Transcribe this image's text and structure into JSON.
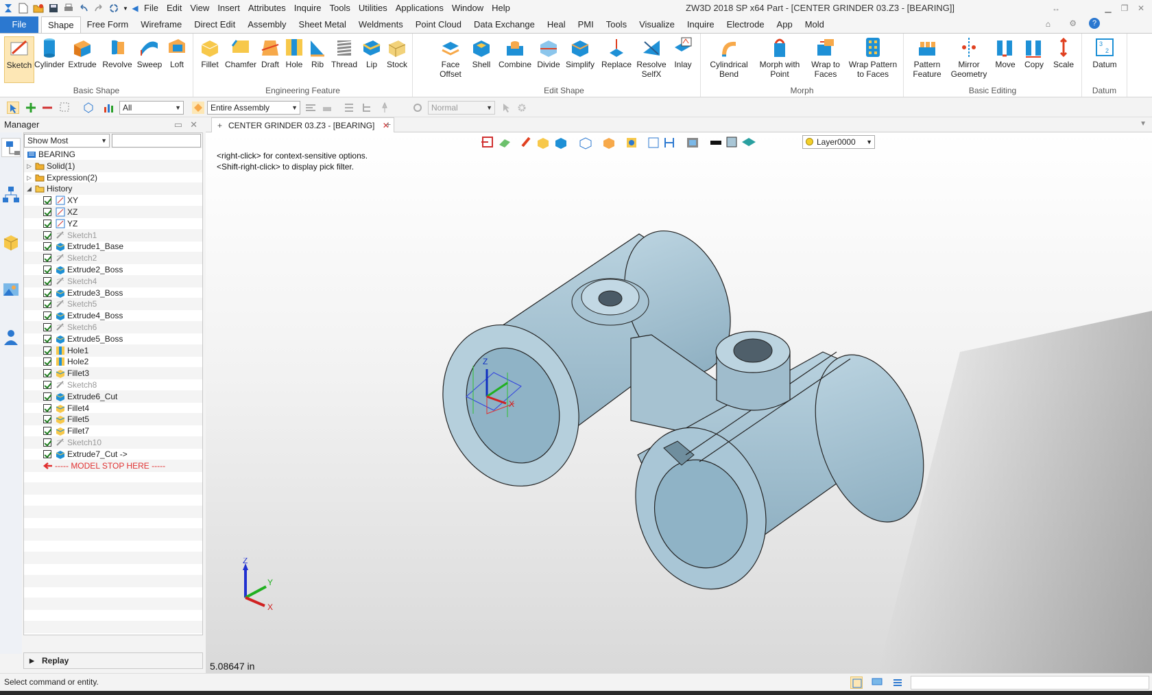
{
  "app": {
    "title": "ZW3D 2018 SP x64     Part - [CENTER GRINDER 03.Z3 - [BEARING]]"
  },
  "menu": [
    "File",
    "Edit",
    "View",
    "Insert",
    "Attributes",
    "Inquire",
    "Tools",
    "Utilities",
    "Applications",
    "Window",
    "Help"
  ],
  "tabs": [
    "File",
    "Shape",
    "Free Form",
    "Wireframe",
    "Direct Edit",
    "Assembly",
    "Sheet Metal",
    "Weldments",
    "Point Cloud",
    "Data Exchange",
    "Heal",
    "PMI",
    "Tools",
    "Visualize",
    "Inquire",
    "Electrode",
    "App",
    "Mold"
  ],
  "ribbon": {
    "groups": {
      "basic_shape": "Basic Shape",
      "engineering_feature": "Engineering Feature",
      "edit_shape": "Edit Shape",
      "morph": "Morph",
      "basic_editing": "Basic Editing",
      "datum": "Datum"
    },
    "buttons": {
      "sketch": "Sketch",
      "cylinder": "Cylinder",
      "extrude": "Extrude",
      "revolve": "Revolve",
      "sweep": "Sweep",
      "loft": "Loft",
      "fillet": "Fillet",
      "chamfer": "Chamfer",
      "draft": "Draft",
      "hole": "Hole",
      "rib": "Rib",
      "thread": "Thread",
      "lip": "Lip",
      "stock": "Stock",
      "face_offset_1": "Face",
      "face_offset_2": "Offset",
      "shell": "Shell",
      "combine": "Combine",
      "divide": "Divide",
      "simplify": "Simplify",
      "replace": "Replace",
      "resolve_1": "Resolve",
      "resolve_2": "SelfX",
      "inlay": "Inlay",
      "cyl_bend_1": "Cylindrical",
      "cyl_bend_2": "Bend",
      "morph_pt_1": "Morph with",
      "morph_pt_2": "Point",
      "wrap_faces_1": "Wrap to",
      "wrap_faces_2": "Faces",
      "wrap_pattern_1": "Wrap Pattern",
      "wrap_pattern_2": "to Faces",
      "pattern_1": "Pattern",
      "pattern_2": "Feature",
      "mirror_1": "Mirror",
      "mirror_2": "Geometry",
      "move": "Move",
      "copy": "Copy",
      "scale": "Scale",
      "datum": "Datum"
    }
  },
  "toolbar": {
    "filter": "All",
    "scope": "Entire Assembly",
    "mode": "Normal"
  },
  "manager": {
    "title": "Manager",
    "filter": "Show Most",
    "replay": "Replay",
    "tree": [
      {
        "label": "BEARING",
        "type": "root",
        "grey": false
      },
      {
        "label": "Solid(1)",
        "type": "folder",
        "grey": false
      },
      {
        "label": "Expression(2)",
        "type": "folder",
        "grey": false
      },
      {
        "label": "History",
        "type": "folder-open",
        "grey": false
      },
      {
        "label": "XY",
        "type": "plane",
        "grey": false
      },
      {
        "label": "XZ",
        "type": "plane",
        "grey": false
      },
      {
        "label": "YZ",
        "type": "plane",
        "grey": false
      },
      {
        "label": "Sketch1",
        "type": "sketch",
        "grey": true
      },
      {
        "label": "Extrude1_Base",
        "type": "feature",
        "grey": false
      },
      {
        "label": "Sketch2",
        "type": "sketch",
        "grey": true
      },
      {
        "label": "Extrude2_Boss",
        "type": "feature",
        "grey": false
      },
      {
        "label": "Sketch4",
        "type": "sketch",
        "grey": true
      },
      {
        "label": "Extrude3_Boss",
        "type": "feature",
        "grey": false
      },
      {
        "label": "Sketch5",
        "type": "sketch",
        "grey": true
      },
      {
        "label": "Extrude4_Boss",
        "type": "feature",
        "grey": false
      },
      {
        "label": "Sketch6",
        "type": "sketch",
        "grey": true
      },
      {
        "label": "Extrude5_Boss",
        "type": "feature",
        "grey": false
      },
      {
        "label": "Hole1",
        "type": "hole",
        "grey": false
      },
      {
        "label": "Hole2",
        "type": "hole",
        "grey": false
      },
      {
        "label": "Fillet3",
        "type": "fillet",
        "grey": false
      },
      {
        "label": "Sketch8",
        "type": "sketch",
        "grey": true
      },
      {
        "label": "Extrude6_Cut",
        "type": "feature",
        "grey": false
      },
      {
        "label": "Fillet4",
        "type": "fillet",
        "grey": false
      },
      {
        "label": "Fillet5",
        "type": "fillet",
        "grey": false
      },
      {
        "label": "Fillet7",
        "type": "fillet",
        "grey": false
      },
      {
        "label": "Sketch10",
        "type": "sketch",
        "grey": true
      },
      {
        "label": "Extrude7_Cut ->",
        "type": "feature",
        "grey": false
      },
      {
        "label": "----- MODEL STOP HERE -----",
        "type": "stop",
        "grey": false
      }
    ]
  },
  "document": {
    "tab": "CENTER GRINDER 03.Z3 - [BEARING]",
    "hint1": "<right-click> for context-sensitive options.",
    "hint2": "<Shift-right-click> to display pick filter.",
    "layer": "Layer0000",
    "distance": "5.08647 in"
  },
  "status": {
    "text": "Select command or entity."
  },
  "colors": {
    "accent": "#2b78d0",
    "part": "#a9c6d6",
    "stop": "#e03030"
  }
}
